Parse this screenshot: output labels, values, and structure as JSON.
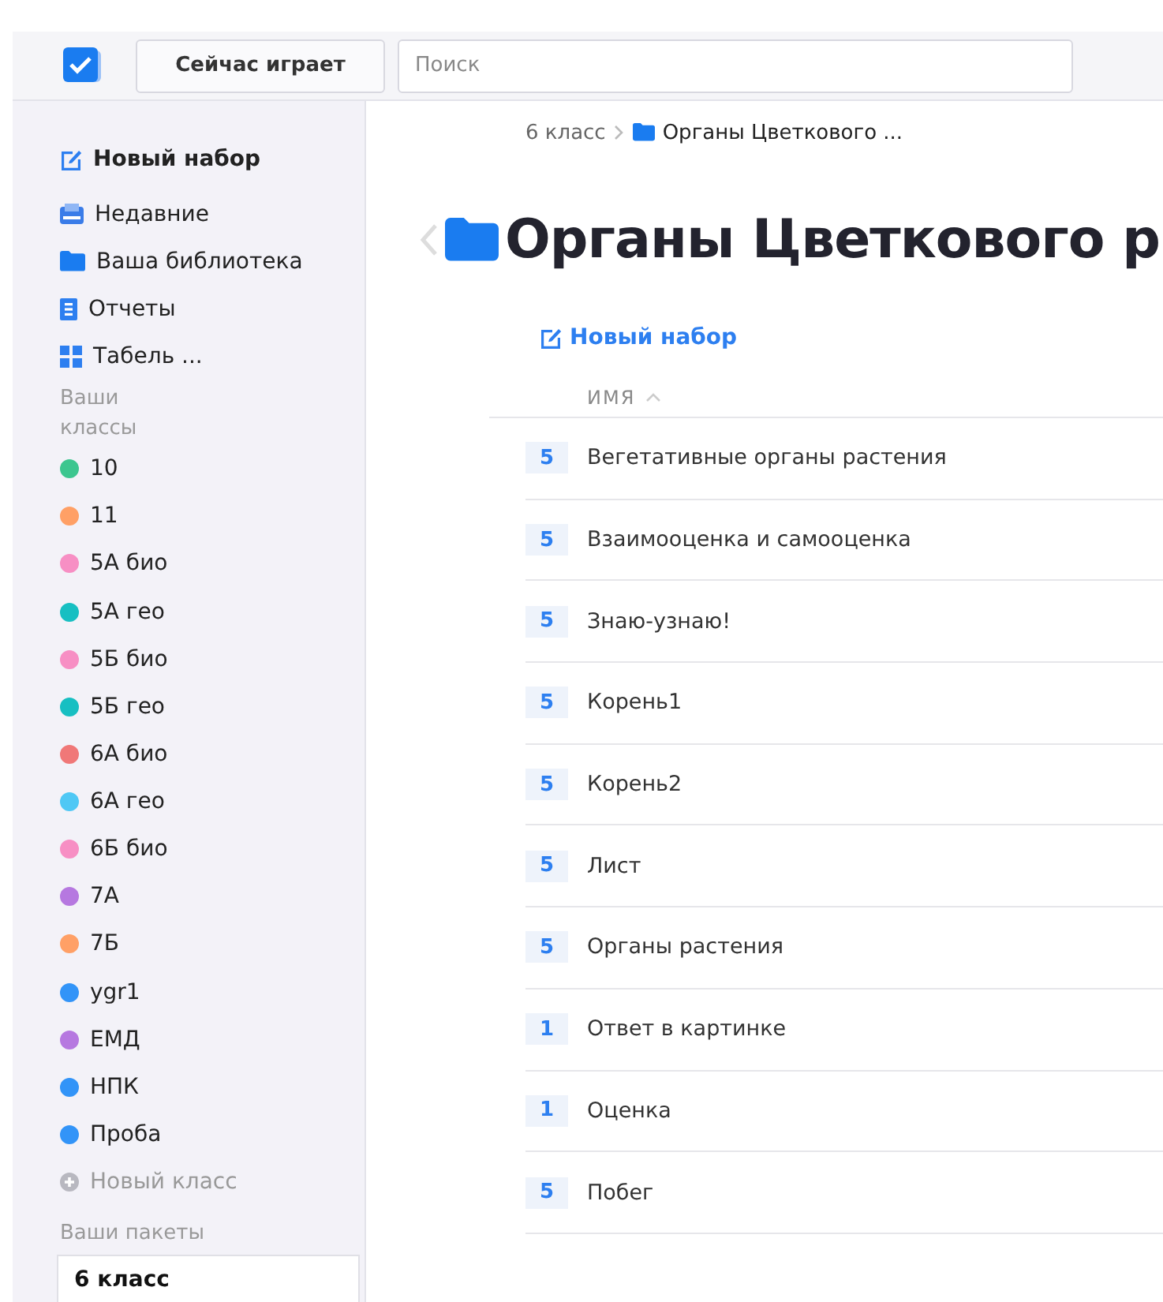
{
  "header": {
    "now_playing_button": "Сейчас играет",
    "search": {
      "placeholder": "Поиск"
    }
  },
  "sidebar": {
    "new_set": "Новый набор",
    "nav": [
      {
        "kind": "recent",
        "label": "Недавние"
      },
      {
        "kind": "library",
        "label": "Ваша библиотека"
      },
      {
        "kind": "reports",
        "label": "Отчеты"
      },
      {
        "kind": "grid",
        "label": "Табель ..."
      }
    ],
    "classes_heading": "Ваши классы",
    "classes": [
      {
        "label": "10",
        "color": "#3cc68f"
      },
      {
        "label": "11",
        "color": "#ffa066"
      },
      {
        "label": "5А био",
        "color": "#f78fc4"
      },
      {
        "label": "5А гео",
        "color": "#17bfc2"
      },
      {
        "label": "5Б био",
        "color": "#f78fc4"
      },
      {
        "label": "5Б гео",
        "color": "#17bfc2"
      },
      {
        "label": "6А био",
        "color": "#f07878"
      },
      {
        "label": "6А гео",
        "color": "#4fc8f5"
      },
      {
        "label": "6Б био",
        "color": "#f78fc4"
      },
      {
        "label": "7А",
        "color": "#b678e0"
      },
      {
        "label": "7Б",
        "color": "#ffa066"
      },
      {
        "label": "ygr1",
        "color": "#3294f8"
      },
      {
        "label": "ЕМД",
        "color": "#b678e0"
      },
      {
        "label": "НПК",
        "color": "#3294f8"
      },
      {
        "label": "Проба",
        "color": "#3294f8"
      }
    ],
    "new_class": "Новый класс",
    "packages_heading": "Ваши пакеты",
    "packages": [
      {
        "label": "6 класс",
        "selected": true
      }
    ]
  },
  "breadcrumb": [
    {
      "kind": "text",
      "label": "6 класс"
    },
    {
      "kind": "folder",
      "label": "Органы Цветкового ..."
    }
  ],
  "title": "Органы Цветкового р",
  "new_set_link": "Новый набор",
  "table": {
    "column": "ИМЯ",
    "rows": [
      {
        "count": "5",
        "name": "Вегетативные органы растения"
      },
      {
        "count": "5",
        "name": "Взаимооценка и самооценка"
      },
      {
        "count": "5",
        "name": "Знаю-узнаю!"
      },
      {
        "count": "5",
        "name": "Корень1"
      },
      {
        "count": "5",
        "name": "Корень2"
      },
      {
        "count": "5",
        "name": "Лист"
      },
      {
        "count": "5",
        "name": "Органы растения"
      },
      {
        "count": "1",
        "name": "Ответ в картинке"
      },
      {
        "count": "1",
        "name": "Оценка"
      },
      {
        "count": "5",
        "name": "Побег"
      }
    ]
  }
}
